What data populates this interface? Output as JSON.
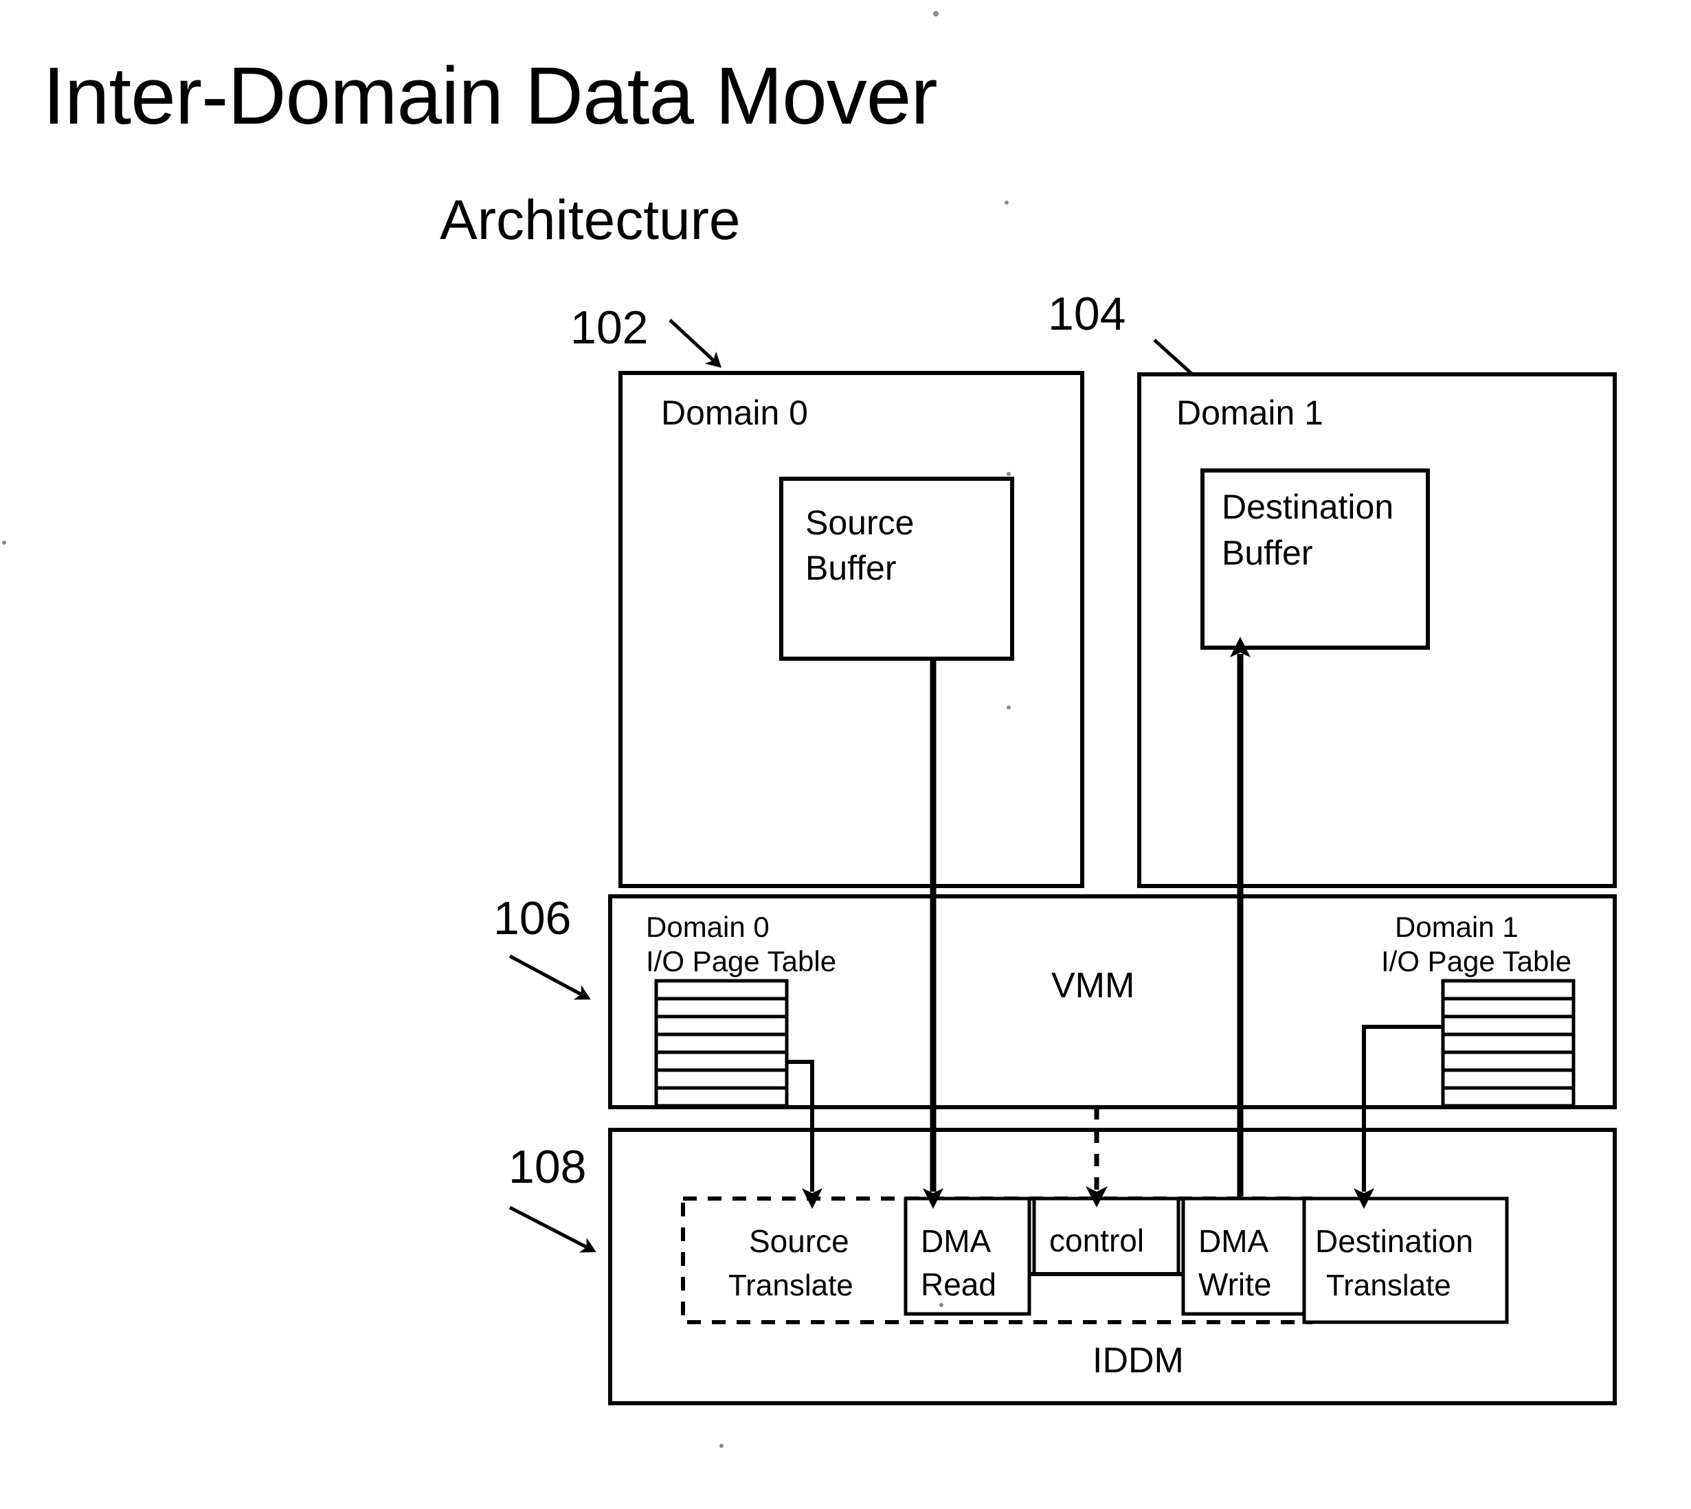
{
  "title": {
    "main": "Inter-Domain Data Mover",
    "sub": "Architecture"
  },
  "reference_numerals": {
    "domain0": "102",
    "domain1": "104",
    "vmm": "106",
    "iddm": "108"
  },
  "domains": {
    "domain0": {
      "label": "Domain 0",
      "buffer_line1": "Source",
      "buffer_line2": "Buffer"
    },
    "domain1": {
      "label": "Domain 1",
      "buffer_line1": "Destination",
      "buffer_line2": "Buffer"
    }
  },
  "vmm": {
    "label": "VMM",
    "left_table": {
      "line1": "Domain 0",
      "line2": "I/O Page Table",
      "rows": 7
    },
    "right_table": {
      "line1": "Domain 1",
      "line2": "I/O Page Table",
      "rows": 7
    }
  },
  "iddm": {
    "label": "IDDM",
    "units": [
      {
        "name": "source-translate",
        "line1": "Source",
        "line2": "Translate",
        "style": "dashed-region"
      },
      {
        "name": "dma-read",
        "line1": "DMA",
        "line2": "Read",
        "style": "solid"
      },
      {
        "name": "control",
        "line1": "control",
        "line2": "",
        "style": "solid"
      },
      {
        "name": "dma-write",
        "line1": "DMA",
        "line2": "Write",
        "style": "solid"
      },
      {
        "name": "destination-translate",
        "line1": "Destination",
        "line2": "Translate",
        "style": "solid"
      }
    ]
  },
  "colors": {
    "ink": "#000000",
    "paper": "#ffffff"
  }
}
